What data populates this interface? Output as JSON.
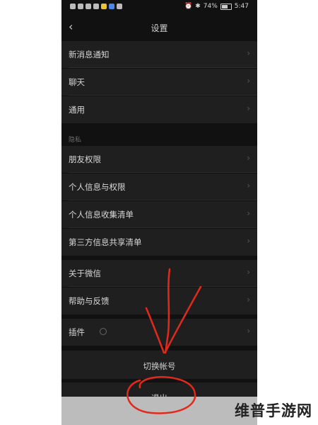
{
  "status_bar": {
    "battery": "74%",
    "time": "5:47"
  },
  "header": {
    "title": "设置",
    "back_icon": "chevron-left-icon"
  },
  "group1": [
    {
      "label": "新消息通知"
    },
    {
      "label": "聊天"
    },
    {
      "label": "通用"
    }
  ],
  "privacy_section": {
    "label": "隐私",
    "items": [
      {
        "label": "朋友权限"
      },
      {
        "label": "个人信息与权限"
      },
      {
        "label": "个人信息收集清单"
      },
      {
        "label": "第三方信息共享清单"
      }
    ]
  },
  "group3": [
    {
      "label": "关于微信"
    },
    {
      "label": "帮助与反馈"
    }
  ],
  "plugins": {
    "label": "插件"
  },
  "switch_account": {
    "label": "切换帐号"
  },
  "logout": {
    "label": "退出"
  },
  "watermark": "维普手游网",
  "colors": {
    "background": "#111111",
    "row": "#1f1f1f",
    "annotation": "#e22a1c"
  }
}
